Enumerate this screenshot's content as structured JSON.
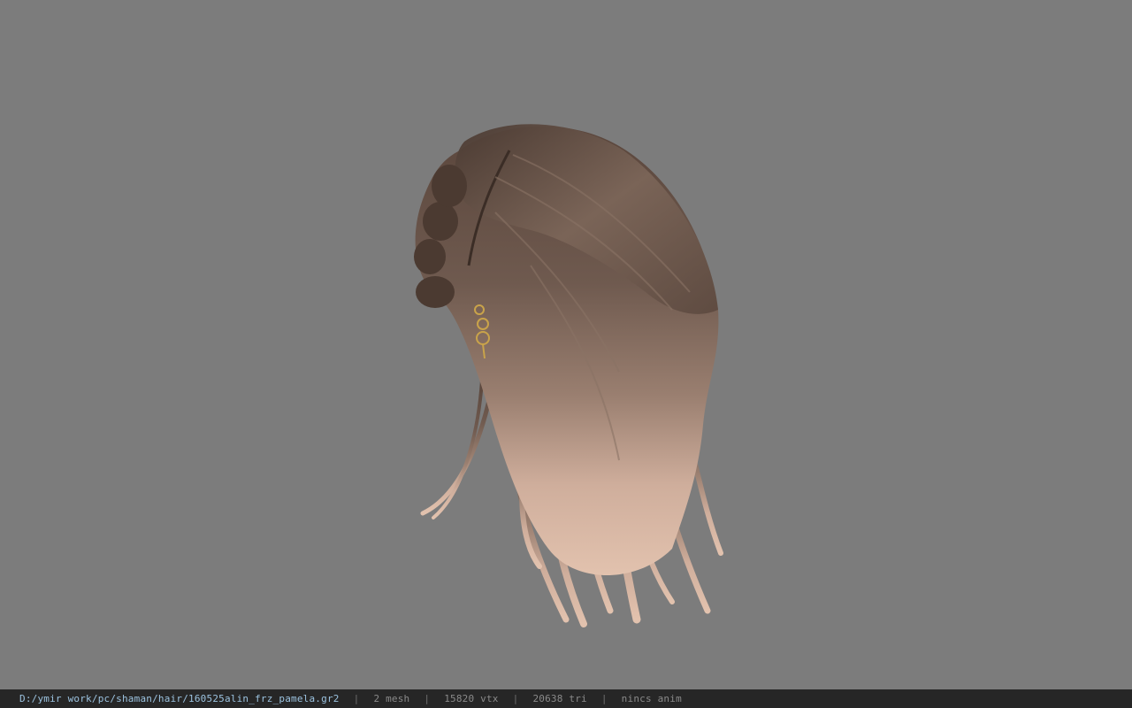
{
  "viewer": {
    "background_color": "#7c7c7c",
    "model_icon": "hair-model-icon"
  },
  "status": {
    "path": "D:/ymir work/pc/shaman/hair/160525alin_frz_pamela.gr2",
    "separator": "|",
    "mesh": "2 mesh",
    "vertices": "15820 vtx",
    "triangles": "20638 tri",
    "anim": "nincs anim",
    "bar_color": "#262626",
    "path_color": "#9cc3e0"
  }
}
